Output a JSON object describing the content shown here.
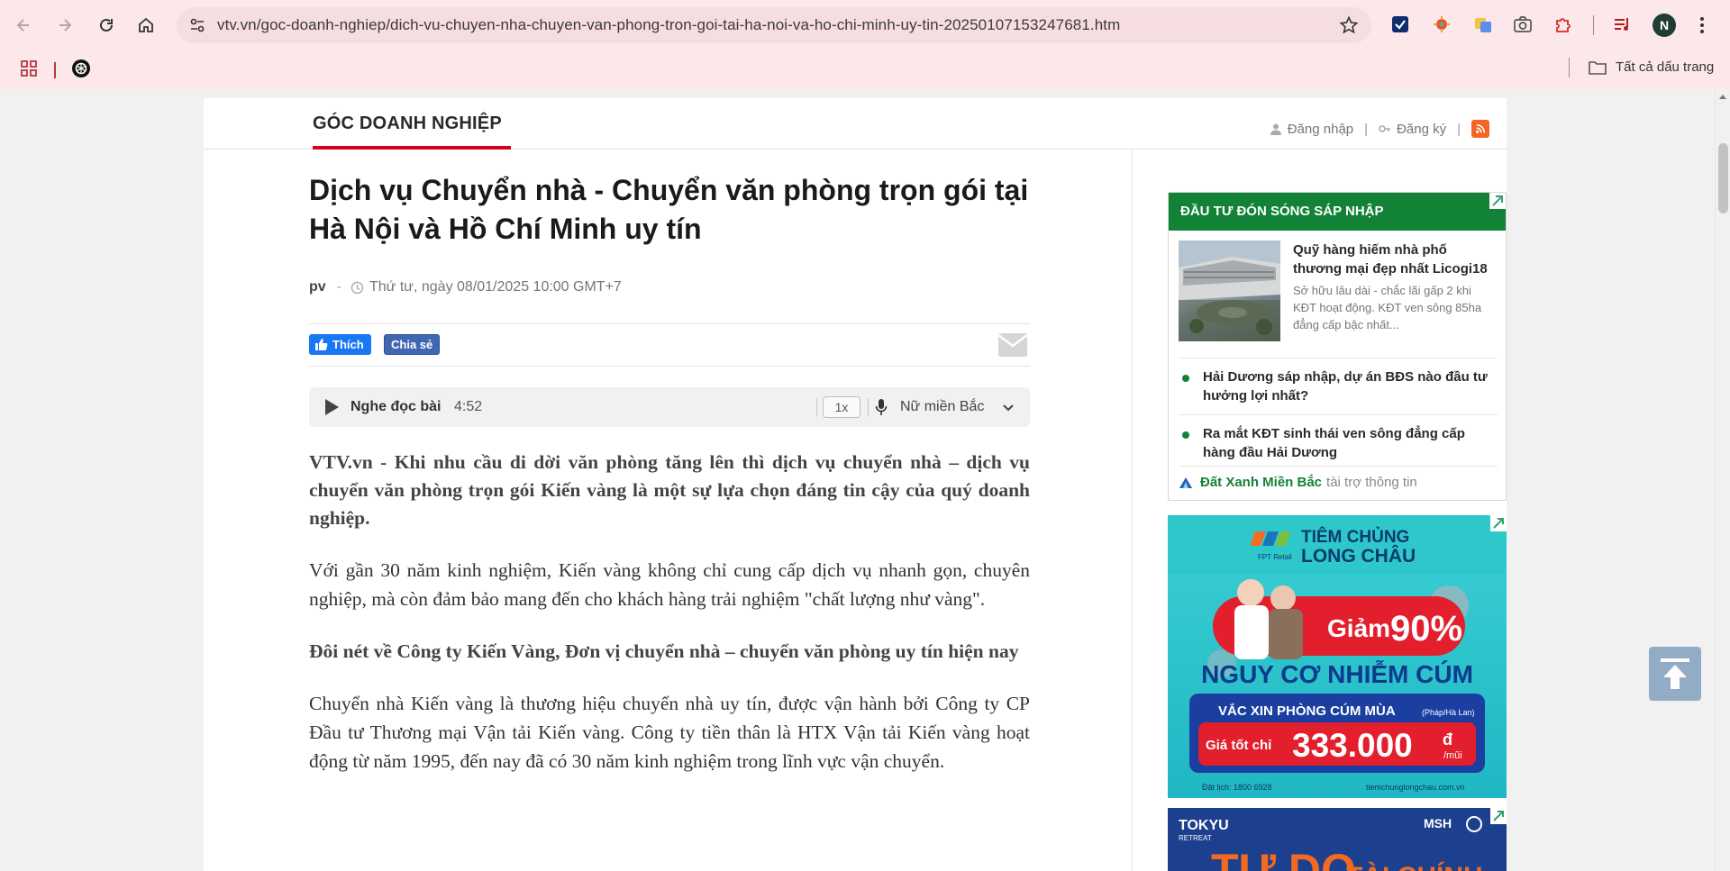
{
  "browser": {
    "url": "vtv.vn/goc-doanh-nghiep/dich-vu-chuyen-nha-chuyen-van-phong-tron-goi-tai-ha-noi-va-ho-chi-minh-uy-tin-20250107153247681.htm",
    "profile_initial": "N",
    "bookmarks_all_label": "Tất cả dấu trang",
    "chrome_bg": "#fce8ea"
  },
  "header": {
    "category": "GÓC DOANH NGHIỆP",
    "login": "Đăng nhập",
    "register": "Đăng ký",
    "accent": "#d0021b"
  },
  "article": {
    "title": "Dịch vụ Chuyển nhà - Chuyển văn phòng trọn gói tại Hà Nội và Hồ Chí Minh uy tín",
    "author": "pv",
    "date": "Thứ tư, ngày 08/01/2025 10:00 GMT+7",
    "like_label": "Thích",
    "share_label": "Chia sẻ",
    "audio_label": "Nghe đọc bài",
    "audio_time": "4:52",
    "audio_speed": "1x",
    "audio_voice": "Nữ miền Bắc",
    "lead": "VTV.vn - Khi nhu cầu di dời văn phòng tăng lên thì dịch vụ chuyển nhà – dịch vụ chuyển văn phòng trọn gói Kiến vàng là một sự lựa chọn đáng tin cậy của quý doanh nghiệp.",
    "para1": "Với gần 30 năm kinh nghiệm, Kiến vàng không chỉ cung cấp dịch vụ nhanh gọn, chuyên nghiệp, mà còn đảm bảo mang đến cho khách hàng trải nghiệm \"chất lượng như vàng\".",
    "subhead": "Đôi nét về Công ty Kiến Vàng, Đơn vị chuyển nhà – chuyển văn phòng uy tín hiện nay",
    "para2": "Chuyển nhà Kiến vàng là thương hiệu chuyển nhà uy tín, được vận hành bởi Công ty CP Đầu tư Thương mại Vận tải Kiến vàng. Công ty tiền thân là HTX Vận tải Kiến vàng hoạt động từ năm 1995, đến nay đã có 30 năm kinh nghiệm trong lĩnh vực vận chuyển."
  },
  "sidebar": {
    "box_title": "ĐẦU TƯ ĐÓN SÓNG SÁP NHẬP",
    "box_color": "#128236",
    "featured_title": "Quỹ hàng hiếm nhà phố thương mại đẹp nhất Licogi18",
    "featured_desc": "Sở hữu lâu dài - chắc lãi gấp 2 khi KĐT hoạt động. KĐT ven sông 85ha đẳng cấp bậc nhất...",
    "items": [
      {
        "title": "Hải Dương sáp nhập, dự án BĐS nào đầu tư hưởng lợi nhất?"
      },
      {
        "title": "Ra mắt KĐT sinh thái ven sông đẳng cấp hàng đầu Hải Dương"
      }
    ],
    "sponsor_brand": "Đất Xanh Miền Bắc",
    "sponsor_suffix": "tài trợ thông tin"
  },
  "ads": {
    "banner1": {
      "brand_top": "TIÊM CHỦNG",
      "brand_bottom": "LONG CHÂU",
      "brand_small": "FPT Retail",
      "discount_prefix": "Giảm",
      "discount": "90%",
      "headline": "NGUY CƠ NHIỄM CÚM",
      "vaccine": "VẮC XIN PHÒNG CÚM MÙA",
      "vaccine_origin": "(Pháp/Hà Lan)",
      "price_label": "Giá tốt chỉ",
      "price": "333.000",
      "price_unit": "đ",
      "price_per": "/mũi",
      "phone": "Đặt lịch: 1800 6928",
      "site": "tiemchunglongchau.com.vn"
    },
    "banner2": {
      "brand": "TOKYU",
      "brand_sub": "RETREAT",
      "partner": "MSH",
      "headline": "TỰ DO",
      "headline2": "TÀI CHÍNH"
    }
  }
}
